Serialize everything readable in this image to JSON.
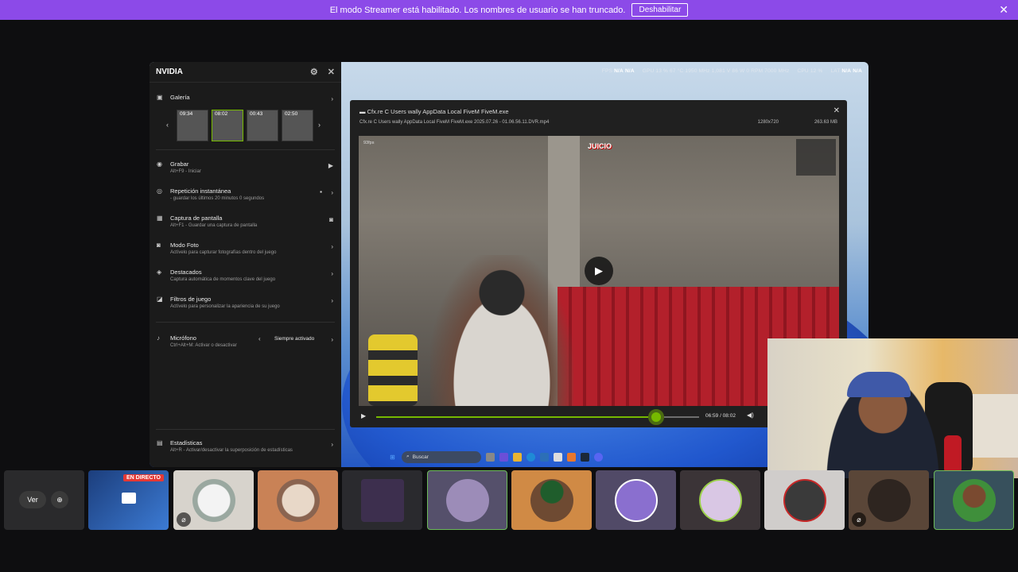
{
  "banner": {
    "message": "El modo Streamer está habilitado. Los nombres de usuario se han truncado.",
    "button": "Deshabilitar",
    "close_icon": "✕"
  },
  "stats": {
    "fps_label": "FPS",
    "fps_val1": "N/A",
    "fps_val2": "N/A",
    "gpu": "GPU 13 % 67 °C 1950 MHz 1,081 V 86 W 0 RPM 7000 MHz",
    "cpu": "CPU 12 %",
    "lat_label": "LAT",
    "lat_val1": "N/A",
    "lat_val2": "N/A"
  },
  "nvidia": {
    "title": "NVIDIA",
    "gallery": {
      "label": "Galería",
      "thumbs": [
        "09:34",
        "08:02",
        "00:43",
        "02:50"
      ]
    },
    "items": [
      {
        "title": "Grabar",
        "sub": "Alt+F9 - Iniciar"
      },
      {
        "title": "Repetición instantánea",
        "sub": "- guardar los últimos 20 minutos 0 segundos"
      },
      {
        "title": "Captura de pantalla",
        "sub": "Alt+F1 - Guardar una captura de pantalla"
      },
      {
        "title": "Modo Foto",
        "sub": "Actívelo para capturar fotografías dentro del juego"
      },
      {
        "title": "Destacados",
        "sub": "Captura automática de momentos clave del juego"
      },
      {
        "title": "Filtros de juego",
        "sub": "Actívelo para personalizar la apariencia de su juego"
      },
      {
        "title": "Micrófono",
        "sub": "Ctrl+Alt+M: Activar o desactivar",
        "value": "Siempre activado"
      },
      {
        "title": "Estadísticas",
        "sub": "Alt+R - Activar/desactivar la superposición de estadísticas"
      }
    ]
  },
  "player": {
    "title": "Cfx.re C Users wally AppData Local FiveM FiveM.exe",
    "subtitle": "Cfx.re C Users wally AppData Local FiveM FiveM.exe 2025.07.26 - 01.06.56.11.DVR.mp4",
    "resolution": "1280x720",
    "size": "263.63 MB",
    "time": "06:59 / 08:02",
    "progress": 0.868,
    "logo": "JUICIO",
    "fps_tag": "93fps"
  },
  "taskbar": {
    "search": "Buscar"
  },
  "participants": {
    "live_badge": "EN DIRECTO",
    "ver_label": "Ver"
  }
}
